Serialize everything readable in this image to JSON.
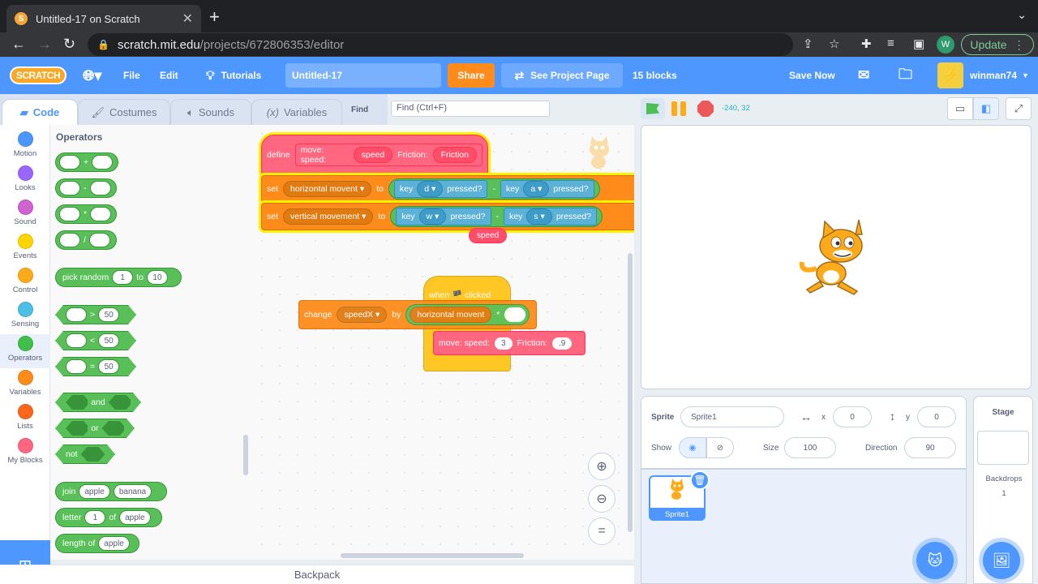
{
  "browser": {
    "tab_title": "Untitled-17 on Scratch",
    "url_host": "scratch.mit.edu",
    "url_path": "/projects/672806353/editor",
    "profile_letter": "W",
    "update_label": "Update"
  },
  "menubar": {
    "logo": "SCRATCH",
    "file": "File",
    "edit": "Edit",
    "tutorials": "Tutorials",
    "project_title": "Untitled-17",
    "share": "Share",
    "see_project": "See Project Page",
    "block_count": "15 blocks",
    "save_now": "Save Now",
    "username": "winman74"
  },
  "tabs": {
    "code": "Code",
    "costumes": "Costumes",
    "sounds": "Sounds",
    "variables": "Variables",
    "find_label": "Find",
    "find_placeholder": "Find (Ctrl+F)"
  },
  "categories": [
    {
      "label": "Motion",
      "color": "#4c97ff"
    },
    {
      "label": "Looks",
      "color": "#9966ff"
    },
    {
      "label": "Sound",
      "color": "#cf63cf"
    },
    {
      "label": "Events",
      "color": "#ffd500"
    },
    {
      "label": "Control",
      "color": "#ffab19"
    },
    {
      "label": "Sensing",
      "color": "#4cbfe6"
    },
    {
      "label": "Operators",
      "color": "#40bf4a"
    },
    {
      "label": "Variables",
      "color": "#ff8c1a"
    },
    {
      "label": "Lists",
      "color": "#ff661a"
    },
    {
      "label": "My Blocks",
      "color": "#ff6680"
    }
  ],
  "palette": {
    "title": "Operators",
    "add": "+",
    "sub": "-",
    "mul": "*",
    "div": "/",
    "pick_random": "pick random",
    "pick_from": "1",
    "pick_to_word": "to",
    "pick_to": "10",
    "gt": ">",
    "lt": "<",
    "eq": "=",
    "cmp_value": "50",
    "and": "and",
    "or": "or",
    "not": "not",
    "join": "join",
    "join_a": "apple",
    "join_b": "banana",
    "letter": "letter",
    "letter_n": "1",
    "of": "of",
    "letter_of": "apple",
    "length_of": "length of",
    "length_val": "apple"
  },
  "script": {
    "define": "define",
    "proc_name": "move: speed:",
    "arg_speed": "speed",
    "friction_label": "Friction:",
    "arg_friction": "Friction",
    "set1": "set",
    "var_h": "horizontal movent",
    "to": "to",
    "key": "key",
    "key_d": "d",
    "key_a": "a",
    "pressed": "pressed?",
    "minus": "-",
    "set2": "set",
    "var_v": "vertical movement",
    "key_w": "w",
    "key_s": "s",
    "speed_drag": "speed",
    "when_clicked": "when 🏴 clicked",
    "change": "change",
    "var_speedx": "speedX",
    "by": "by",
    "reporter_h": "horizontal movent",
    "times": "*",
    "call_name": "move: speed:",
    "call_speed": "3",
    "call_friction_label": "Friction:",
    "call_friction": ".9"
  },
  "backpack": "Backpack",
  "stage": {
    "coords": "-240, 32"
  },
  "sprite_info": {
    "sprite_label": "Sprite",
    "sprite_name": "Sprite1",
    "x_label": "x",
    "x": "0",
    "y_label": "y",
    "y": "0",
    "show_label": "Show",
    "size_label": "Size",
    "size": "100",
    "direction_label": "Direction",
    "direction": "90",
    "thumb_name": "Sprite1"
  },
  "stage_panel": {
    "title": "Stage",
    "backdrops_label": "Backdrops",
    "backdrops_count": "1"
  }
}
